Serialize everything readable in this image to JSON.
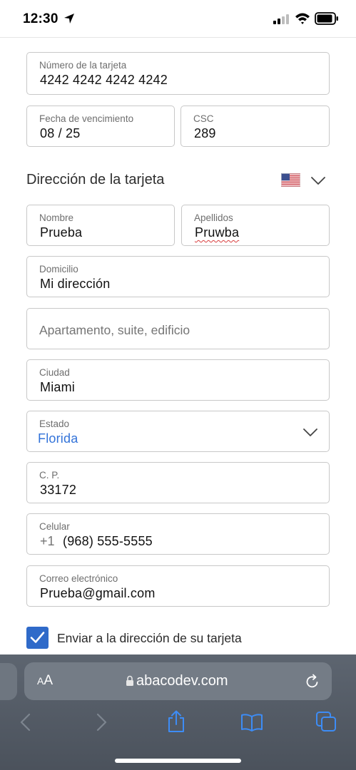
{
  "status_bar": {
    "time": "12:30",
    "icons": [
      "location-arrow-icon",
      "cellular-signal-icon",
      "wifi-icon",
      "battery-icon"
    ]
  },
  "card": {
    "number_label": "Número de la tarjeta",
    "number_value": "4242 4242 4242 4242",
    "expiry_label": "Fecha de vencimiento",
    "expiry_value": "08 / 25",
    "csc_label": "CSC",
    "csc_value": "289"
  },
  "address_section": {
    "title": "Dirección de la tarjeta",
    "country_flag": "us-flag-icon",
    "first_name_label": "Nombre",
    "first_name_value": "Prueba",
    "last_name_label": "Apellidos",
    "last_name_value": "Pruwba",
    "address_label": "Domicilio",
    "address_value": "Mi dirección",
    "address2_placeholder": "Apartamento, suite, edificio",
    "city_label": "Ciudad",
    "city_value": "Miami",
    "state_label": "Estado",
    "state_value": "Florida",
    "zip_label": "C. P.",
    "zip_value": "33172",
    "phone_label": "Celular",
    "phone_prefix": "+1",
    "phone_value": "(968) 555-5555",
    "email_label": "Correo electrónico",
    "email_value": "Prueba@gmail.com"
  },
  "ship_to_card": {
    "checked": true,
    "label": "Enviar a la dirección de su tarjeta"
  },
  "browser": {
    "aa_label": "AA",
    "url": "abacodev.com",
    "toolbar": [
      "back-icon",
      "forward-icon",
      "share-icon",
      "bookmarks-icon",
      "tabs-icon"
    ]
  },
  "colors": {
    "accent_blue": "#3373d9",
    "checkbox_blue": "#2f6ac9",
    "field_border": "#c8c8c8",
    "toolbar_bg": "#4f5660"
  }
}
